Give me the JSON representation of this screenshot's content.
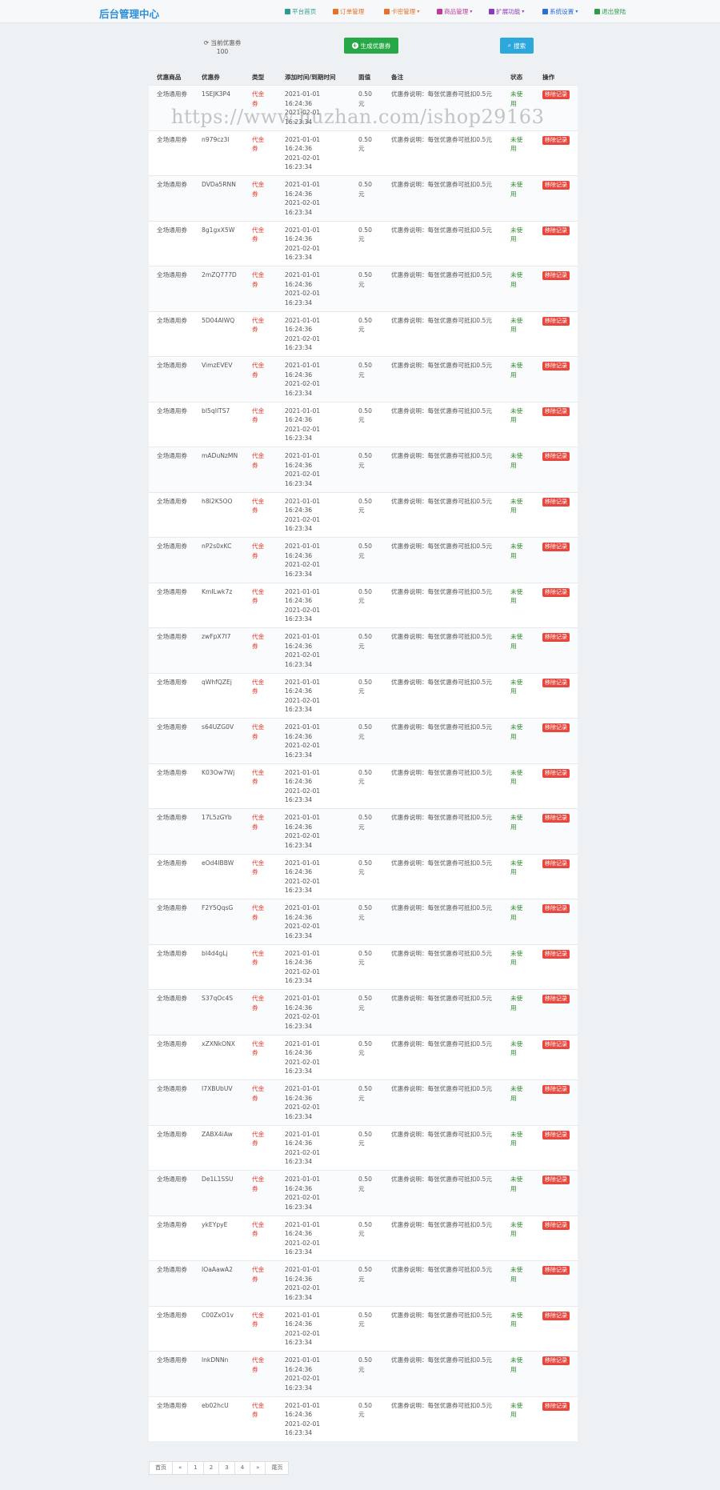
{
  "brand": "后台管理中心",
  "nav": [
    {
      "label": "平台首页",
      "icon": "user-icon",
      "color": "#2a9d8f",
      "caret": false
    },
    {
      "label": "订单管理",
      "icon": "list-icon",
      "color": "#e8702a",
      "caret": false
    },
    {
      "label": "卡密管理",
      "icon": "card-icon",
      "color": "#e8702a",
      "caret": true
    },
    {
      "label": "商品管理",
      "icon": "goods-icon",
      "color": "#c03a9c",
      "caret": true
    },
    {
      "label": "扩展功能",
      "icon": "extend-icon",
      "color": "#8a3ac0",
      "caret": true
    },
    {
      "label": "系统设置",
      "icon": "gear-icon",
      "color": "#2a6fd8",
      "caret": true
    },
    {
      "label": "退出登陆",
      "icon": "logout-icon",
      "color": "#2a9d4a",
      "caret": false
    }
  ],
  "toolbar": {
    "pending_label": "当前优惠券",
    "pending_count": "100",
    "generate_label": "生成优惠券",
    "search_label": "搜索"
  },
  "table": {
    "headers": [
      "优惠商品",
      "优惠券",
      "类型",
      "添加时间/到期时间",
      "面值",
      "备注",
      "状态",
      "操作"
    ],
    "rows": [
      {
        "goods": "全场通用券",
        "code": "1SEJK3P4",
        "type": "代金券",
        "added": "2021-01-01 16:24:36",
        "expires": "2021-02-01 16:23:34",
        "value": "0.50元",
        "note": "优惠券说明：每张优惠券可抵扣0.5元",
        "status": "未使用",
        "action": "移除记录"
      },
      {
        "goods": "全场通用券",
        "code": "n979cz3l",
        "type": "代金券",
        "added": "2021-01-01 16:24:36",
        "expires": "2021-02-01 16:23:34",
        "value": "0.50元",
        "note": "优惠券说明：每张优惠券可抵扣0.5元",
        "status": "未使用",
        "action": "移除记录"
      },
      {
        "goods": "全场通用券",
        "code": "DVDa5RNN",
        "type": "代金券",
        "added": "2021-01-01 16:24:36",
        "expires": "2021-02-01 16:23:34",
        "value": "0.50元",
        "note": "优惠券说明：每张优惠券可抵扣0.5元",
        "status": "未使用",
        "action": "移除记录"
      },
      {
        "goods": "全场通用券",
        "code": "8g1gxX5W",
        "type": "代金券",
        "added": "2021-01-01 16:24:36",
        "expires": "2021-02-01 16:23:34",
        "value": "0.50元",
        "note": "优惠券说明：每张优惠券可抵扣0.5元",
        "status": "未使用",
        "action": "移除记录"
      },
      {
        "goods": "全场通用券",
        "code": "2mZQ777D",
        "type": "代金券",
        "added": "2021-01-01 16:24:36",
        "expires": "2021-02-01 16:23:34",
        "value": "0.50元",
        "note": "优惠券说明：每张优惠券可抵扣0.5元",
        "status": "未使用",
        "action": "移除记录"
      },
      {
        "goods": "全场通用券",
        "code": "5D04AIWQ",
        "type": "代金券",
        "added": "2021-01-01 16:24:36",
        "expires": "2021-02-01 16:23:34",
        "value": "0.50元",
        "note": "优惠券说明：每张优惠券可抵扣0.5元",
        "status": "未使用",
        "action": "移除记录"
      },
      {
        "goods": "全场通用券",
        "code": "VimzEVEV",
        "type": "代金券",
        "added": "2021-01-01 16:24:36",
        "expires": "2021-02-01 16:23:34",
        "value": "0.50元",
        "note": "优惠券说明：每张优惠券可抵扣0.5元",
        "status": "未使用",
        "action": "移除记录"
      },
      {
        "goods": "全场通用券",
        "code": "bI5qIlTS7",
        "type": "代金券",
        "added": "2021-01-01 16:24:36",
        "expires": "2021-02-01 16:23:34",
        "value": "0.50元",
        "note": "优惠券说明：每张优惠券可抵扣0.5元",
        "status": "未使用",
        "action": "移除记录"
      },
      {
        "goods": "全场通用券",
        "code": "mADuNzMN",
        "type": "代金券",
        "added": "2021-01-01 16:24:36",
        "expires": "2021-02-01 16:23:34",
        "value": "0.50元",
        "note": "优惠券说明：每张优惠券可抵扣0.5元",
        "status": "未使用",
        "action": "移除记录"
      },
      {
        "goods": "全场通用券",
        "code": "h8I2K5OO",
        "type": "代金券",
        "added": "2021-01-01 16:24:36",
        "expires": "2021-02-01 16:23:34",
        "value": "0.50元",
        "note": "优惠券说明：每张优惠券可抵扣0.5元",
        "status": "未使用",
        "action": "移除记录"
      },
      {
        "goods": "全场通用券",
        "code": "nP2s0xKC",
        "type": "代金券",
        "added": "2021-01-01 16:24:36",
        "expires": "2021-02-01 16:23:34",
        "value": "0.50元",
        "note": "优惠券说明：每张优惠券可抵扣0.5元",
        "status": "未使用",
        "action": "移除记录"
      },
      {
        "goods": "全场通用券",
        "code": "KmILwk7z",
        "type": "代金券",
        "added": "2021-01-01 16:24:36",
        "expires": "2021-02-01 16:23:34",
        "value": "0.50元",
        "note": "优惠券说明：每张优惠券可抵扣0.5元",
        "status": "未使用",
        "action": "移除记录"
      },
      {
        "goods": "全场通用券",
        "code": "zwFpX7I7",
        "type": "代金券",
        "added": "2021-01-01 16:24:36",
        "expires": "2021-02-01 16:23:34",
        "value": "0.50元",
        "note": "优惠券说明：每张优惠券可抵扣0.5元",
        "status": "未使用",
        "action": "移除记录"
      },
      {
        "goods": "全场通用券",
        "code": "qWhfQZEj",
        "type": "代金券",
        "added": "2021-01-01 16:24:36",
        "expires": "2021-02-01 16:23:34",
        "value": "0.50元",
        "note": "优惠券说明：每张优惠券可抵扣0.5元",
        "status": "未使用",
        "action": "移除记录"
      },
      {
        "goods": "全场通用券",
        "code": "s64UZG0V",
        "type": "代金券",
        "added": "2021-01-01 16:24:36",
        "expires": "2021-02-01 16:23:34",
        "value": "0.50元",
        "note": "优惠券说明：每张优惠券可抵扣0.5元",
        "status": "未使用",
        "action": "移除记录"
      },
      {
        "goods": "全场通用券",
        "code": "K03Ow7Wj",
        "type": "代金券",
        "added": "2021-01-01 16:24:36",
        "expires": "2021-02-01 16:23:34",
        "value": "0.50元",
        "note": "优惠券说明：每张优惠券可抵扣0.5元",
        "status": "未使用",
        "action": "移除记录"
      },
      {
        "goods": "全场通用券",
        "code": "17L5zGYb",
        "type": "代金券",
        "added": "2021-01-01 16:24:36",
        "expires": "2021-02-01 16:23:34",
        "value": "0.50元",
        "note": "优惠券说明：每张优惠券可抵扣0.5元",
        "status": "未使用",
        "action": "移除记录"
      },
      {
        "goods": "全场通用券",
        "code": "eOd4IBBW",
        "type": "代金券",
        "added": "2021-01-01 16:24:36",
        "expires": "2021-02-01 16:23:34",
        "value": "0.50元",
        "note": "优惠券说明：每张优惠券可抵扣0.5元",
        "status": "未使用",
        "action": "移除记录"
      },
      {
        "goods": "全场通用券",
        "code": "F2Y5QqsG",
        "type": "代金券",
        "added": "2021-01-01 16:24:36",
        "expires": "2021-02-01 16:23:34",
        "value": "0.50元",
        "note": "优惠券说明：每张优惠券可抵扣0.5元",
        "status": "未使用",
        "action": "移除记录"
      },
      {
        "goods": "全场通用券",
        "code": "bI4d4gLj",
        "type": "代金券",
        "added": "2021-01-01 16:24:36",
        "expires": "2021-02-01 16:23:34",
        "value": "0.50元",
        "note": "优惠券说明：每张优惠券可抵扣0.5元",
        "status": "未使用",
        "action": "移除记录"
      },
      {
        "goods": "全场通用券",
        "code": "S37qOc4S",
        "type": "代金券",
        "added": "2021-01-01 16:24:36",
        "expires": "2021-02-01 16:23:34",
        "value": "0.50元",
        "note": "优惠券说明：每张优惠券可抵扣0.5元",
        "status": "未使用",
        "action": "移除记录"
      },
      {
        "goods": "全场通用券",
        "code": "xZXNkONX",
        "type": "代金券",
        "added": "2021-01-01 16:24:36",
        "expires": "2021-02-01 16:23:34",
        "value": "0.50元",
        "note": "优惠券说明：每张优惠券可抵扣0.5元",
        "status": "未使用",
        "action": "移除记录"
      },
      {
        "goods": "全场通用券",
        "code": "I7XBUbUV",
        "type": "代金券",
        "added": "2021-01-01 16:24:36",
        "expires": "2021-02-01 16:23:34",
        "value": "0.50元",
        "note": "优惠券说明：每张优惠券可抵扣0.5元",
        "status": "未使用",
        "action": "移除记录"
      },
      {
        "goods": "全场通用券",
        "code": "ZABX4iAw",
        "type": "代金券",
        "added": "2021-01-01 16:24:36",
        "expires": "2021-02-01 16:23:34",
        "value": "0.50元",
        "note": "优惠券说明：每张优惠券可抵扣0.5元",
        "status": "未使用",
        "action": "移除记录"
      },
      {
        "goods": "全场通用券",
        "code": "De1L1SSU",
        "type": "代金券",
        "added": "2021-01-01 16:24:36",
        "expires": "2021-02-01 16:23:34",
        "value": "0.50元",
        "note": "优惠券说明：每张优惠券可抵扣0.5元",
        "status": "未使用",
        "action": "移除记录"
      },
      {
        "goods": "全场通用券",
        "code": "ykEYpyE",
        "type": "代金券",
        "added": "2021-01-01 16:24:36",
        "expires": "2021-02-01 16:23:34",
        "value": "0.50元",
        "note": "优惠券说明：每张优惠券可抵扣0.5元",
        "status": "未使用",
        "action": "移除记录"
      },
      {
        "goods": "全场通用券",
        "code": "IOaAawA2",
        "type": "代金券",
        "added": "2021-01-01 16:24:36",
        "expires": "2021-02-01 16:23:34",
        "value": "0.50元",
        "note": "优惠券说明：每张优惠券可抵扣0.5元",
        "status": "未使用",
        "action": "移除记录"
      },
      {
        "goods": "全场通用券",
        "code": "C00ZxO1v",
        "type": "代金券",
        "added": "2021-01-01 16:24:36",
        "expires": "2021-02-01 16:23:34",
        "value": "0.50元",
        "note": "优惠券说明：每张优惠券可抵扣0.5元",
        "status": "未使用",
        "action": "移除记录"
      },
      {
        "goods": "全场通用券",
        "code": "lnkDNNn",
        "type": "代金券",
        "added": "2021-01-01 16:24:36",
        "expires": "2021-02-01 16:23:34",
        "value": "0.50元",
        "note": "优惠券说明：每张优惠券可抵扣0.5元",
        "status": "未使用",
        "action": "移除记录"
      },
      {
        "goods": "全场通用券",
        "code": "eb02hcU",
        "type": "代金券",
        "added": "2021-01-01 16:24:36",
        "expires": "2021-02-01 16:23:34",
        "value": "0.50元",
        "note": "优惠券说明：每张优惠券可抵扣0.5元",
        "status": "未使用",
        "action": "移除记录"
      }
    ]
  },
  "pagination": [
    "首页",
    "«",
    "1",
    "2",
    "3",
    "4",
    "»",
    "尾页"
  ],
  "watermark": "https://www.huzhan.com/ishop29163"
}
